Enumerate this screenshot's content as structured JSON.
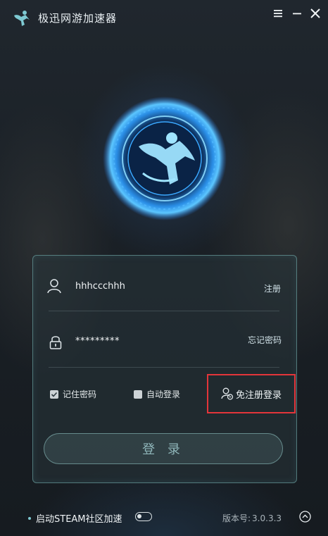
{
  "app": {
    "title": "极迅网游加速器"
  },
  "colors": {
    "accent": "#7ec9d2",
    "highlight_border": "#e3353a",
    "background": "#1a2026"
  },
  "icons": {
    "logo": "runner-logo-icon",
    "menu": "hamburger-menu-icon",
    "minimize": "minimize-icon",
    "close": "close-icon",
    "user": "user-icon",
    "lock": "lock-icon",
    "guest": "guest-user-icon",
    "up": "chevron-up-circle-icon"
  },
  "login": {
    "username_value": "hhhccchhh",
    "password_value": "*********",
    "register_link": "注册",
    "forgot_link": "忘记密码",
    "remember_label": "记住密码",
    "remember_checked": true,
    "autologin_label": "自动登录",
    "autologin_checked": false,
    "guest_login_label": "免注册登录",
    "login_button": "登 录"
  },
  "footer": {
    "steam_label": "启动STEAM社区加速",
    "steam_enabled": false,
    "version_label": "版本号:",
    "version_value": "3.0.3.3"
  }
}
